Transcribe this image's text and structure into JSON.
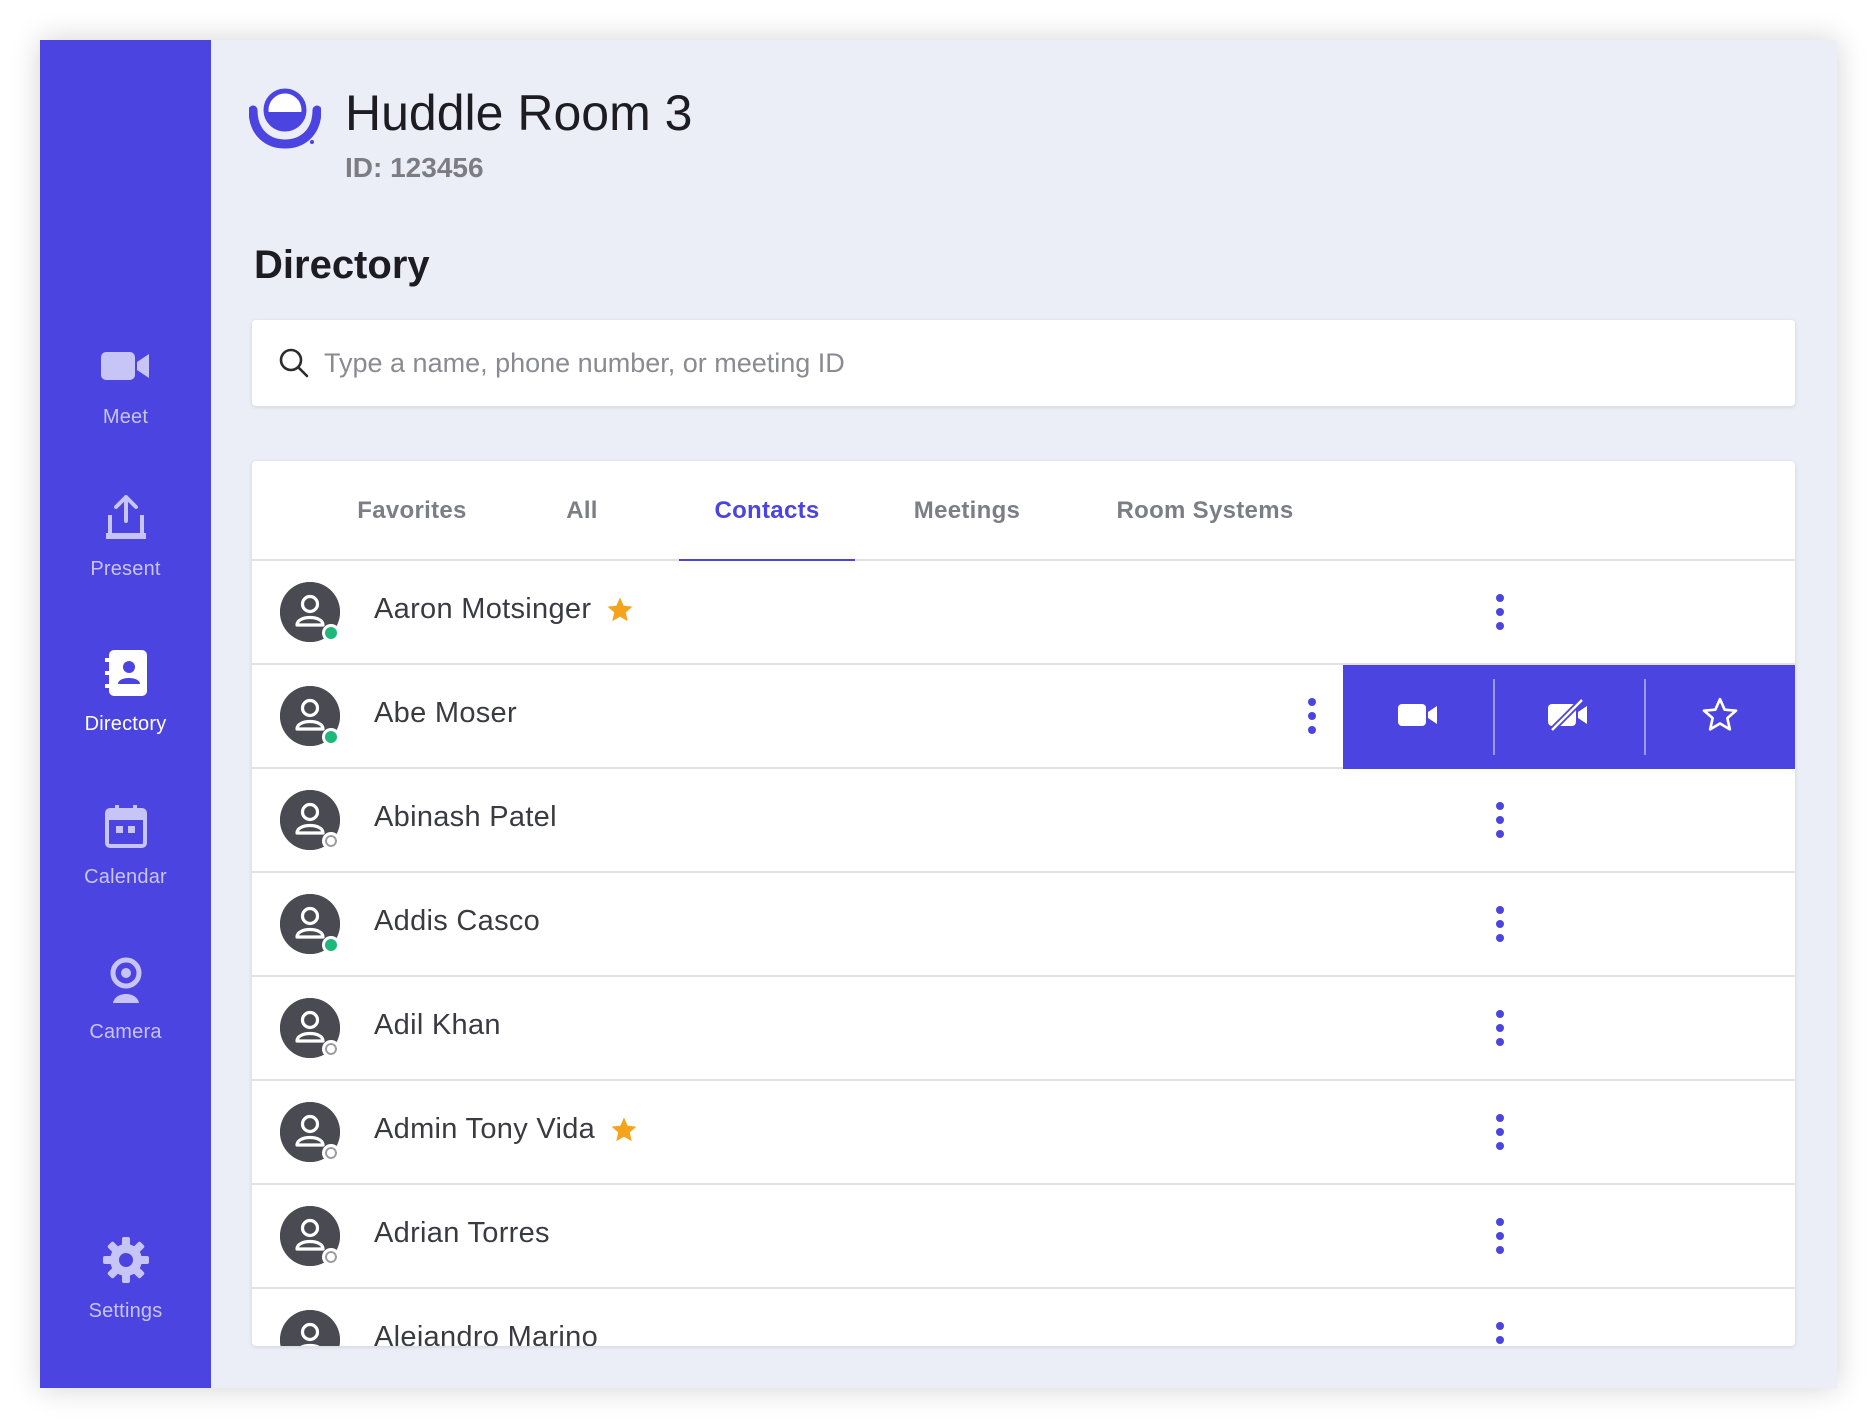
{
  "room": {
    "title": "Huddle Room 3",
    "id_label": "ID: 123456"
  },
  "nav": {
    "meet": "Meet",
    "present": "Present",
    "directory": "Directory",
    "calendar": "Calendar",
    "camera": "Camera",
    "settings": "Settings",
    "active": "Directory"
  },
  "directory": {
    "title": "Directory",
    "search_placeholder": "Type a name, phone number, or meeting ID",
    "tabs": [
      "Favorites",
      "All",
      "Contacts",
      "Meetings",
      "Room Systems"
    ],
    "active_tab": "Contacts"
  },
  "contacts": [
    {
      "name": "Aaron Motsinger",
      "status": "online",
      "favorite": true
    },
    {
      "name": "Abe Moser",
      "status": "online",
      "favorite": false,
      "actions_open": true
    },
    {
      "name": "Abinash Patel",
      "status": "offline",
      "favorite": false
    },
    {
      "name": "Addis Casco",
      "status": "online",
      "favorite": false
    },
    {
      "name": "Adil Khan",
      "status": "offline",
      "favorite": false
    },
    {
      "name": "Admin Tony Vida",
      "status": "offline",
      "favorite": true
    },
    {
      "name": "Adrian Torres",
      "status": "offline",
      "favorite": false
    },
    {
      "name": "Alejandro Marino",
      "status": "offline",
      "favorite": false
    }
  ],
  "row_actions": [
    "video-call-icon",
    "video-off-call-icon",
    "star-outline-icon"
  ],
  "colors": {
    "accent": "#4b44e0",
    "online": "#1fb87c",
    "favorite": "#f5a31a",
    "background": "#eceef7"
  }
}
